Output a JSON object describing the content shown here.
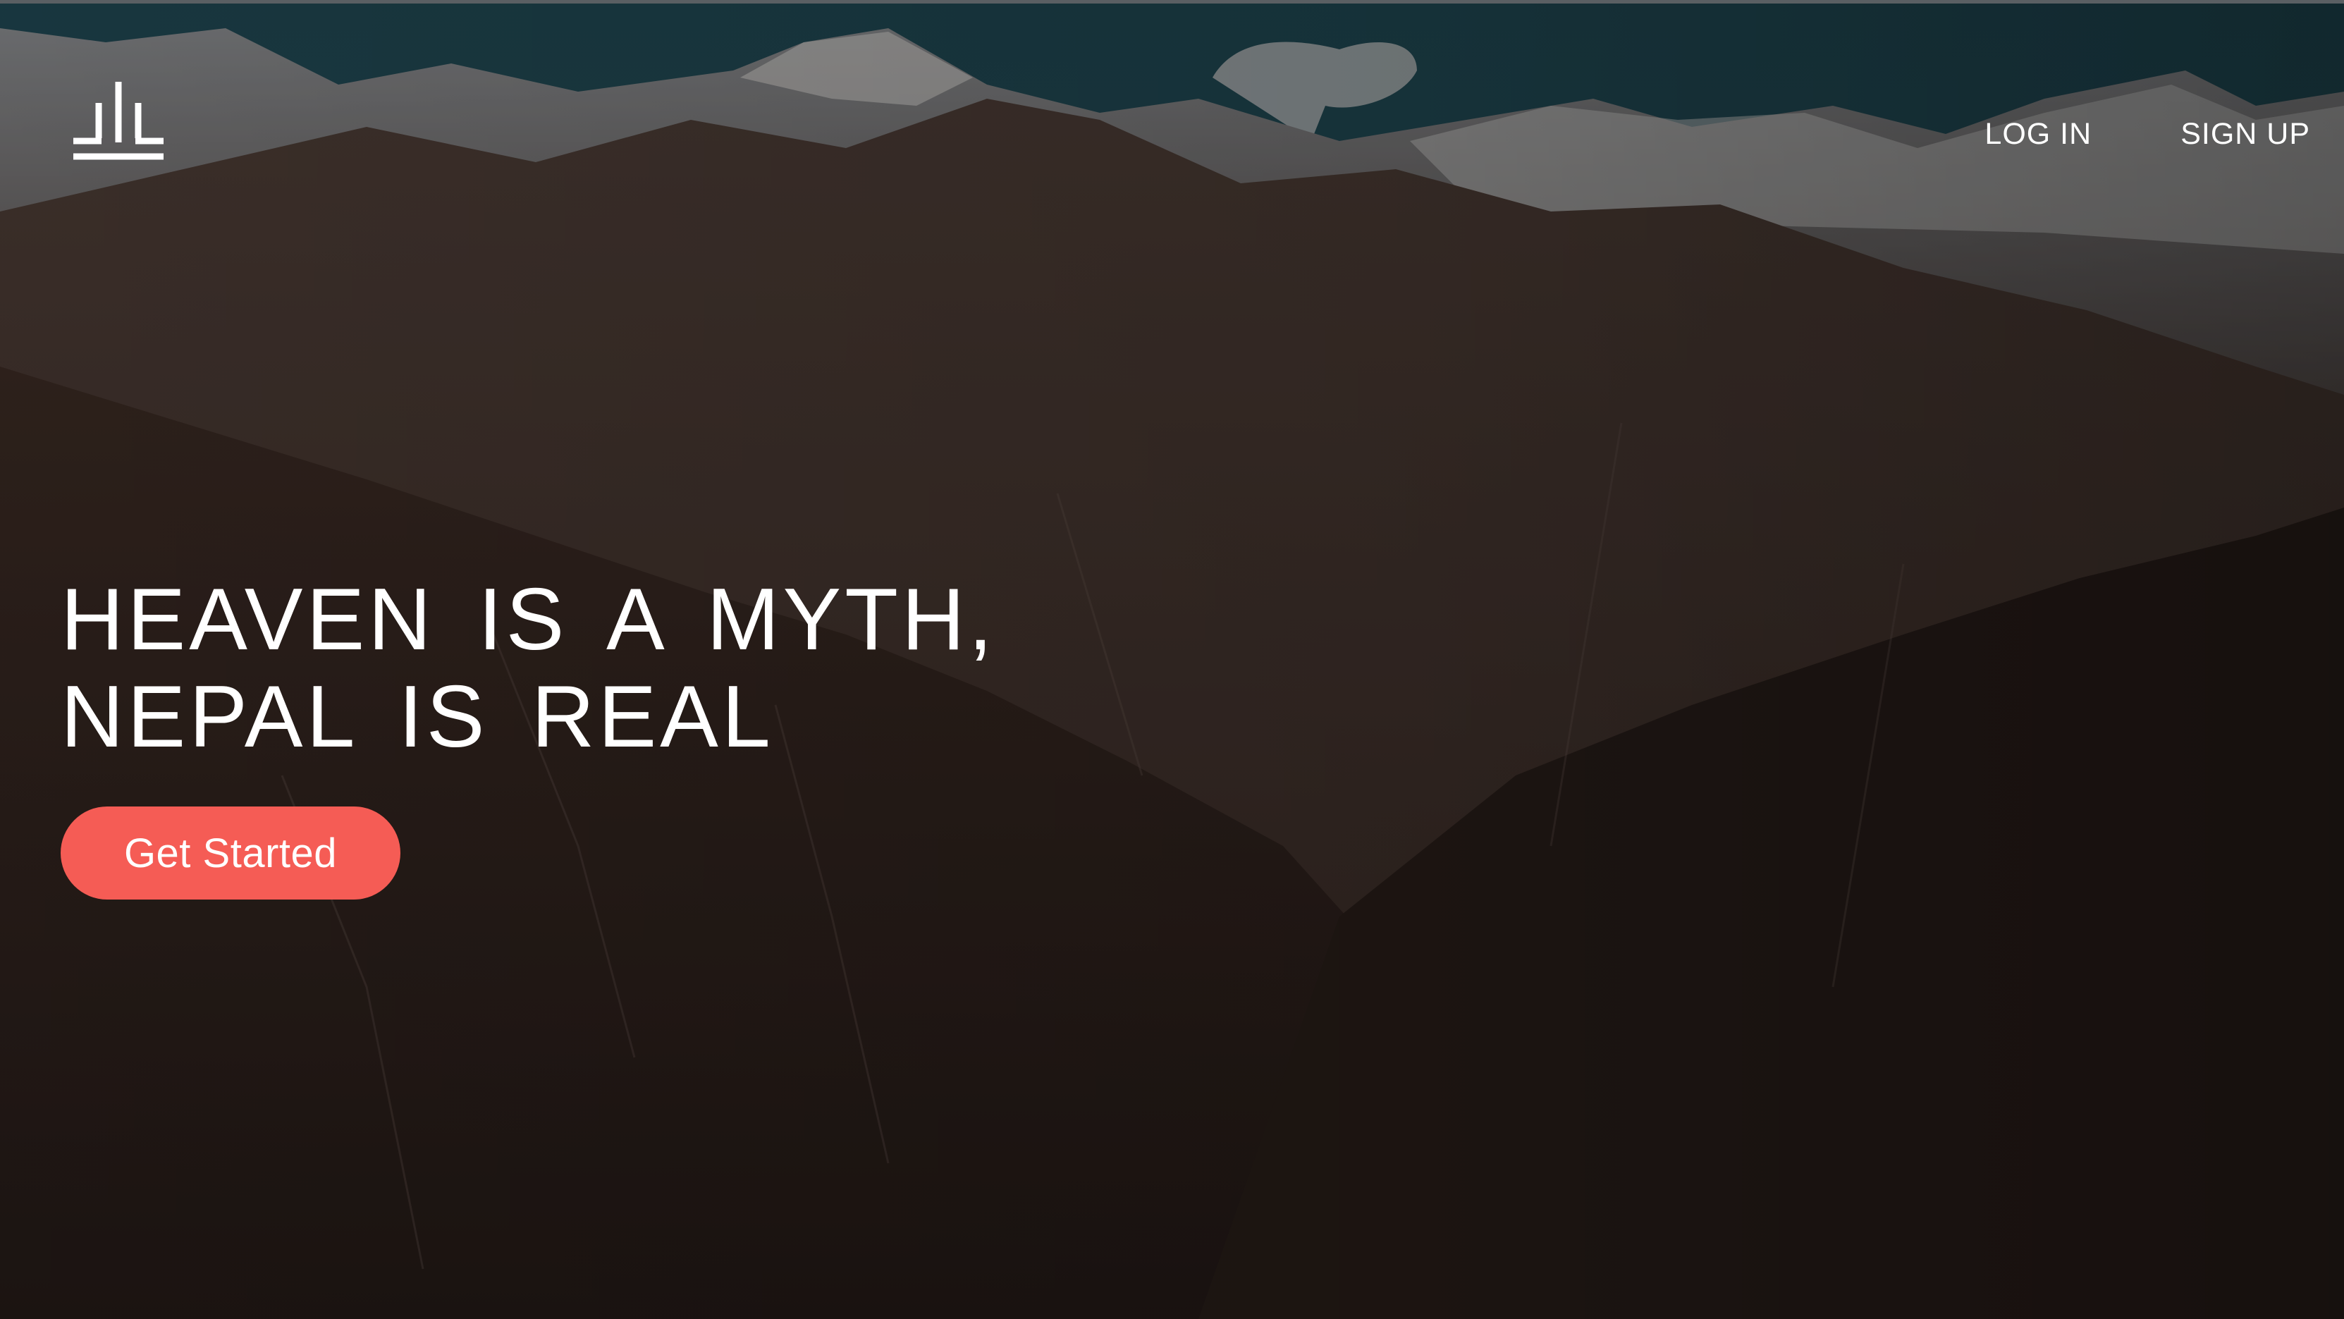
{
  "brand": {
    "logo_icon": "temple-pillars-logo-icon"
  },
  "nav": {
    "login_label": "LOG IN",
    "signup_label": "SIGN UP"
  },
  "hero": {
    "headline_line1": "HEAVEN IS A MYTH,",
    "headline_line2": "NEPAL IS REAL",
    "cta_label": "Get Started",
    "background": "mountain-range-photo"
  },
  "colors": {
    "cta_background": "#f55c55",
    "text": "#ffffff",
    "sky": "#1f4a55"
  }
}
